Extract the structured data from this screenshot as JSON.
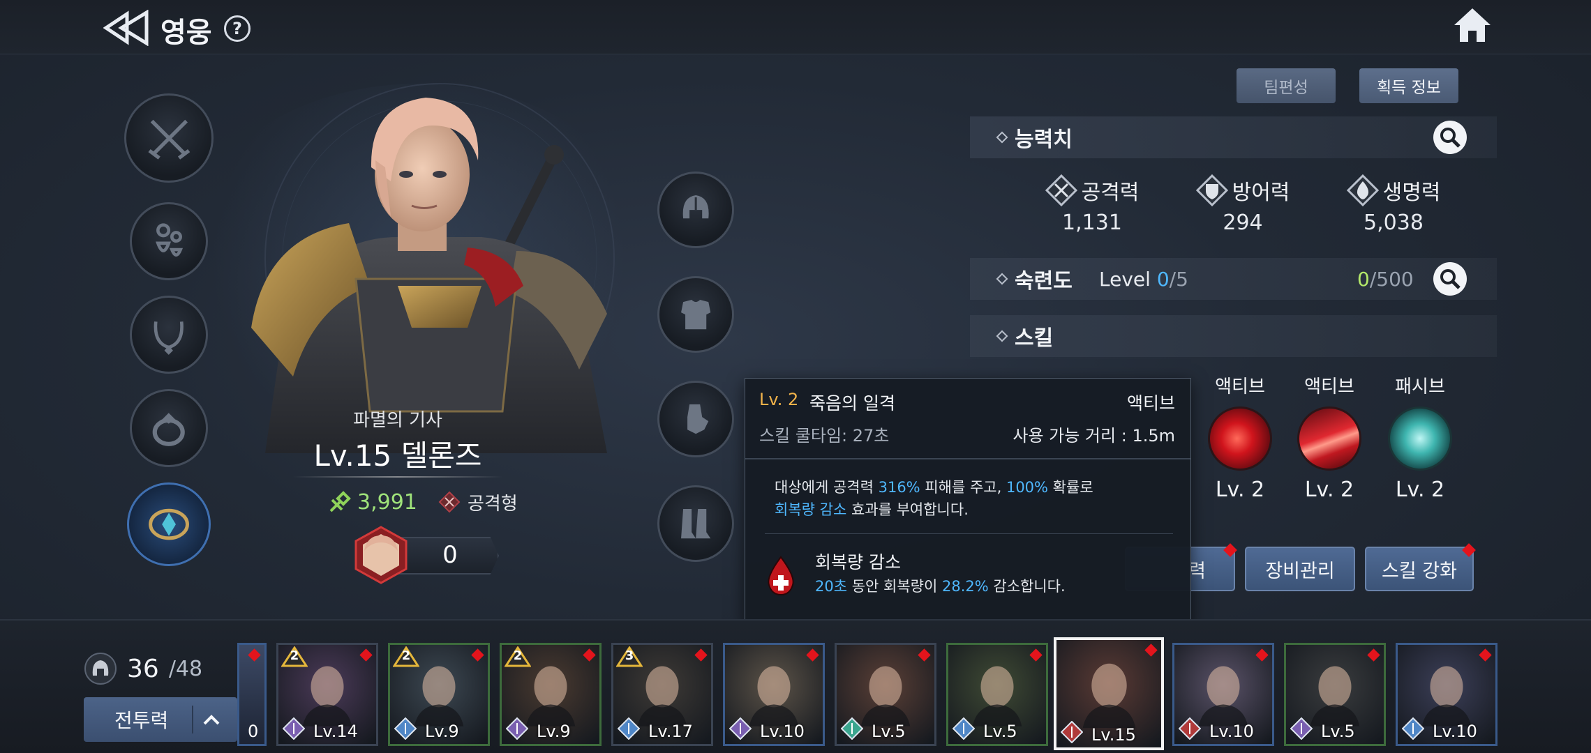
{
  "header": {
    "title": "영웅",
    "help": "?"
  },
  "hero": {
    "class": "파멸의 기사",
    "name": "Lv.15 델론즈",
    "power": "3,991",
    "type": "공격형",
    "shard_count": "0"
  },
  "panel": {
    "team_btn": "팀편성",
    "acquire_btn": "획득 정보",
    "stats_title": "능력치",
    "stats": [
      {
        "name": "공격력",
        "value": "1,131"
      },
      {
        "name": "방어력",
        "value": "294"
      },
      {
        "name": "생명력",
        "value": "5,038"
      }
    ],
    "mastery_title": "숙련도",
    "mastery_level_label": "Level",
    "mastery_level_cur": "0",
    "mastery_level_max": "/5",
    "mastery_pts_cur": "0",
    "mastery_pts_max": "/500",
    "skill_title": "스킬",
    "skills": [
      {
        "kind": "액티브",
        "level": "Lv. 2"
      },
      {
        "kind": "액티브",
        "level": "Lv. 2"
      },
      {
        "kind": "패시브",
        "level": "Lv. 2"
      }
    ],
    "buttons": {
      "partial": "력",
      "equip": "장비관리",
      "skill_up": "스킬 강화"
    }
  },
  "tooltip": {
    "level": "Lv. 2",
    "name": "죽음의 일격",
    "kind": "액티브",
    "cooldown": "스킬 쿨타임: 27초",
    "range": "사용 가능 거리 : 1.5m",
    "desc1": "대상에게 공격력 ",
    "desc_pct1": "316%",
    "desc2": " 피해를 주고, ",
    "desc_pct2": "100%",
    "desc3": " 확률로",
    "desc_effect": "회복량 감소",
    "desc4": " 효과를 부여합니다.",
    "effect_name": "회복량 감소",
    "effect_dur": "20초",
    "effect_mid": " 동안 회복량이 ",
    "effect_pct": "28.2%",
    "effect_end": " 감소합니다."
  },
  "roster": {
    "count_cur": "36",
    "count_max": "/48",
    "sort_label": "전투력",
    "partial_level": "0",
    "cards": [
      {
        "level": "Lv.14",
        "stars": "2",
        "bg": "#4b3a58",
        "cls": "#7a5fb0",
        "frame": "#3a4352"
      },
      {
        "level": "Lv.9",
        "stars": "2",
        "bg": "#3d4852",
        "cls": "#4f86c6",
        "frame": "#3d6b3c"
      },
      {
        "level": "Lv.9",
        "stars": "2",
        "bg": "#4a3a30",
        "cls": "#7a5fb0",
        "frame": "#3d6b3c"
      },
      {
        "level": "Lv.17",
        "stars": "3",
        "bg": "#3e3a36",
        "cls": "#4f86c6",
        "frame": "#3a4352"
      },
      {
        "level": "Lv.10",
        "stars": "",
        "bg": "#5c5348",
        "cls": "#7a5fb0",
        "frame": "#3a5a8a"
      },
      {
        "level": "Lv.5",
        "stars": "",
        "bg": "#5a3f36",
        "cls": "#3aa58e",
        "frame": "#3a4352"
      },
      {
        "level": "Lv.5",
        "stars": "",
        "bg": "#3f4a34",
        "cls": "#4f86c6",
        "frame": "#3d6b3c"
      },
      {
        "level": "Lv.15",
        "stars": "",
        "bg": "#5a3a34",
        "cls": "#b03a3a",
        "frame": "#f3f3f3",
        "selected": true
      },
      {
        "level": "Lv.10",
        "stars": "",
        "bg": "#5a5268",
        "cls": "#b03a3a",
        "frame": "#3a5a8a"
      },
      {
        "level": "Lv.5",
        "stars": "",
        "bg": "#3a3c3e",
        "cls": "#7a5fb0",
        "frame": "#3d6b3c"
      },
      {
        "level": "Lv.10",
        "stars": "",
        "bg": "#3c3f58",
        "cls": "#4f86c6",
        "frame": "#3a5a8a"
      }
    ]
  }
}
